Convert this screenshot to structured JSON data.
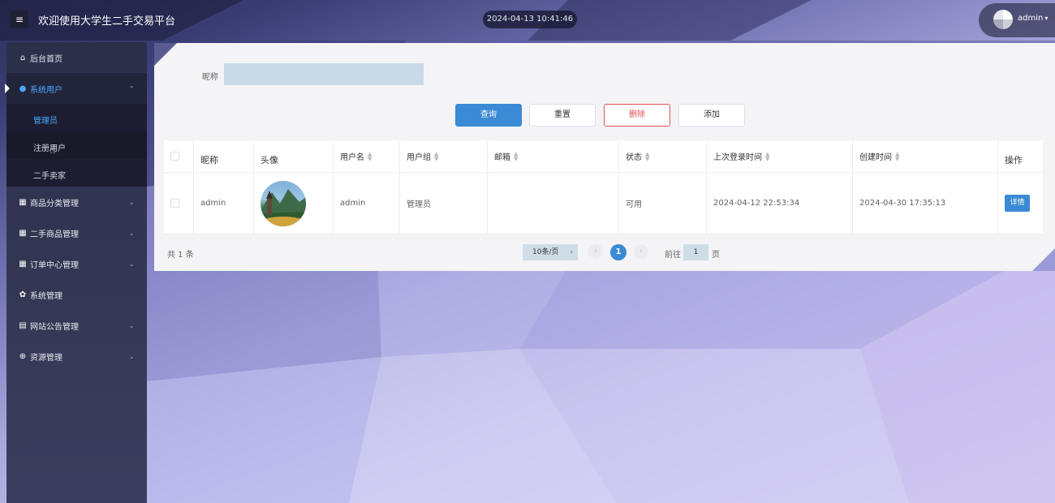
{
  "header": {
    "title": "欢迎使用大学生二手交易平台",
    "datetime": "2024-04-13 10:41:46",
    "user": "admin"
  },
  "sidebar": {
    "items": [
      {
        "label": "后台首页",
        "icon": "home-icon"
      },
      {
        "label": "系统用户",
        "icon": "user-icon",
        "expanded": true
      },
      {
        "label": "商品分类管理",
        "icon": "grid-icon"
      },
      {
        "label": "二手商品管理",
        "icon": "grid-icon"
      },
      {
        "label": "订单中心管理",
        "icon": "grid-icon"
      },
      {
        "label": "系统管理",
        "icon": "gear-icon"
      },
      {
        "label": "网站公告管理",
        "icon": "document-icon"
      },
      {
        "label": "资源管理",
        "icon": "plus-circle-icon"
      }
    ],
    "sub_items": [
      {
        "label": "管理员",
        "current": true
      },
      {
        "label": "注册用户"
      },
      {
        "label": "二手卖家"
      }
    ]
  },
  "search": {
    "label": "昵称",
    "placeholder": ""
  },
  "actions": {
    "query": "查询",
    "reset": "重置",
    "delete": "删除",
    "add": "添加"
  },
  "table": {
    "columns": [
      "昵称",
      "头像",
      "用户名",
      "用户组",
      "邮箱",
      "状态",
      "上次登录时间",
      "创建时间",
      "操作"
    ],
    "rows": [
      {
        "nickname": "admin",
        "username": "admin",
        "group": "管理员",
        "email": "",
        "status": "可用",
        "last_login": "2024-04-12 22:53:34",
        "created": "2024-04-30 17:35:13",
        "action": "详情"
      }
    ]
  },
  "pagination": {
    "total": "共 1 条",
    "page_size": "10条/页",
    "current_page": "1",
    "goto_prefix": "前往",
    "goto_value": "1",
    "goto_suffix": "页"
  },
  "colors": {
    "primary": "#3a8ad6",
    "danger": "#e05252",
    "sidebar": "#2c2f49",
    "active_text": "#4aa8ff"
  }
}
